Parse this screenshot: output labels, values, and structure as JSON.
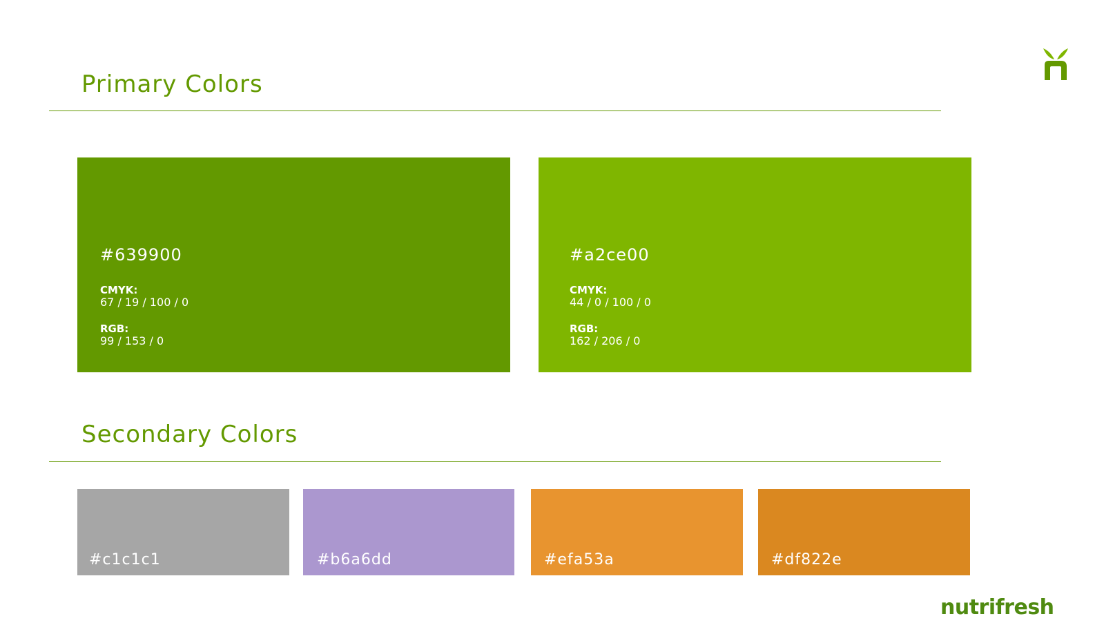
{
  "primary": {
    "title": "Primary Colors",
    "swatches": [
      {
        "hex": "#639900",
        "cmyk_label": "CMYK:",
        "cmyk": "67 / 19 /  100 / 0",
        "rgb_label": "RGB:",
        "rgb": "99 / 153  / 0",
        "color": "#639900"
      },
      {
        "hex": "#a2ce00",
        "cmyk_label": "CMYK:",
        "cmyk": "44 / 0 /  100 / 0",
        "rgb_label": "RGB:",
        "rgb": "162 / 206  / 0",
        "color": "#7fb600"
      }
    ]
  },
  "secondary": {
    "title": "Secondary Colors",
    "swatches": [
      {
        "hex": "#c1c1c1",
        "color": "#a6a6a6"
      },
      {
        "hex": "#b6a6dd",
        "color": "#ab97cf"
      },
      {
        "hex": "#efa53a",
        "color": "#e8942f"
      },
      {
        "hex": "#df822e",
        "color": "#da8820"
      }
    ]
  },
  "brand": {
    "name": "nutrifresh",
    "color": "#4f8a10",
    "icon": "sprout-logo-icon"
  }
}
